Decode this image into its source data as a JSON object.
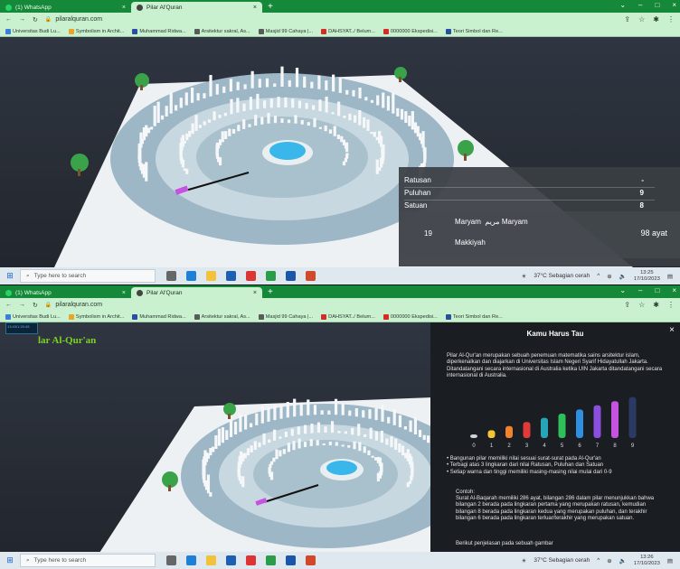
{
  "browser": {
    "tabs": [
      {
        "label": "(1) WhatsApp",
        "icon": "whatsapp-icon"
      },
      {
        "label": "Pilar Al'Quran",
        "icon": "site-icon"
      }
    ],
    "new_tab": "+",
    "url": "pilaralquran.com",
    "bookmarks": [
      "Universitas Budi Lu...",
      "Symbolism in Archit...",
      "Muhammad Ridwa...",
      "Arsitektur sakral, As...",
      "Masjid 99 Cahaya |...",
      "DAHSYAT../ Belum...",
      "0000000 Ekspedisi...",
      "Teori Simbol dan Re..."
    ]
  },
  "shot1": {
    "info": {
      "rows": [
        {
          "label": "Ratusan",
          "value": "-"
        },
        {
          "label": "Puluhan",
          "value": "9"
        },
        {
          "label": "Satuan",
          "value": "8"
        }
      ],
      "surah_number": "19",
      "surah_name": "Maryam",
      "surah_arabic": "مريم",
      "surah_name_2": "Maryam",
      "type": "Makkiyah",
      "ayat": "98 ayat"
    },
    "taskbar": {
      "search_placeholder": "Type here to search",
      "weather": "37°C  Sebagian cerah",
      "time": "13:25",
      "date": "17/10/2023"
    }
  },
  "shot2": {
    "page_title": "lar Al-Qur'an",
    "thumb_text": "13:43/1:20:45",
    "panel": {
      "title": "Kamu Harus Tau",
      "close": "×",
      "intro": "Pilar Al-Qur'an merupakan sebuah penemuan matematika sains arsitektur islam, diperkenalkan dan diajarkan di Universitas Islam Negeri Syarif Hidayatullah Jakarta. Ditandatangani secara internasional di Australia ketika UIN Jakarta ditandatangani secara internasional di Australia.",
      "bars": [
        "0",
        "1",
        "2",
        "3",
        "4",
        "5",
        "6",
        "7",
        "8",
        "9"
      ],
      "bullets": [
        "Bangunan pilar memiliki nilai sesuai surat-surat pada Al-Qur'an",
        "Terbagi atas 3 lingkaran dari nilai Ratusan, Puluhan dan Satuan",
        "Setiap warna dan tinggi memiliki masing-masing nilai mulai dari 0-9"
      ],
      "example_title": "Contoh:",
      "example": "Surat Al-Baqarah memiliki 286 ayat, bilangan 286 dalam pilar menunjukkan bahwa bilangan 2 berada pada lingkaran pertama yang merupakan ratusan, kemudian bilangan 8 berada pada lingkaran kedua yang merupakan puluhan, dan terakhir bilangan 6 berada pada lingkaran terluar/terakhir yang merupakan satuan.",
      "footer": "Berikut penjelasan pada sebuah gambar"
    },
    "taskbar": {
      "search_placeholder": "Type here to search",
      "weather": "37°C  Sebagian cerah",
      "time": "13:26",
      "date": "17/10/2023"
    }
  },
  "colors": {
    "chrome": "#c9f0cf",
    "tabbar": "#15883a",
    "accent_green": "#7ed321",
    "selected_pillar": "#c653e0",
    "bar_colors": [
      "#cfd3d6",
      "#f7c531",
      "#f0832b",
      "#e23a3a",
      "#27a4b5",
      "#2fbf5a",
      "#2f8fe0",
      "#8b4fe0",
      "#c653e0",
      "#2a3a63"
    ]
  }
}
